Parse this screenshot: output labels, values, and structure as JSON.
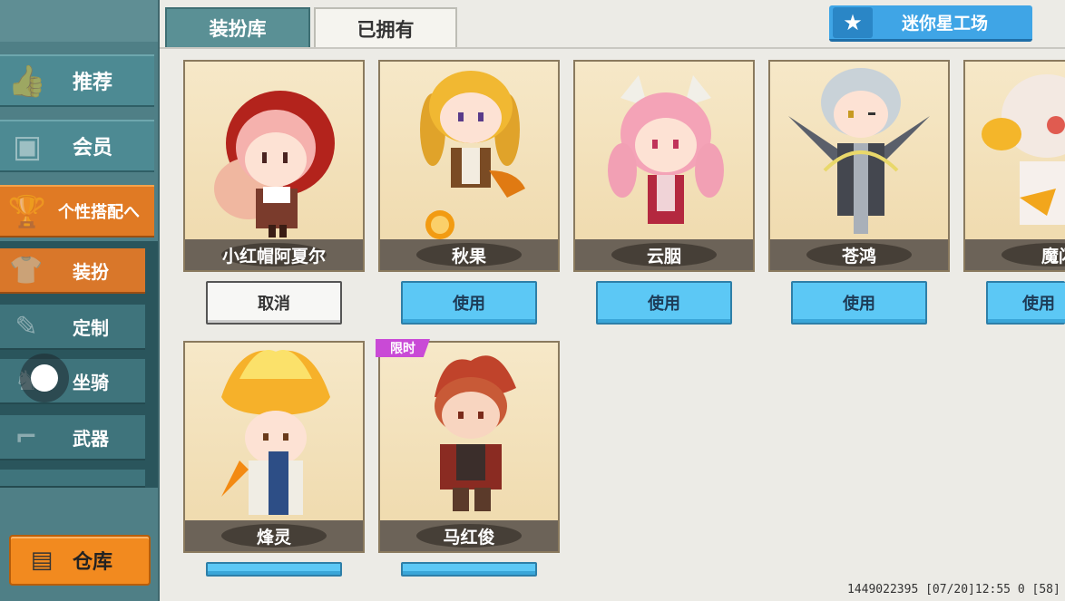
{
  "sidebar": {
    "items": [
      {
        "label": "推荐",
        "icon": "thumbs-up-icon"
      },
      {
        "label": "会员",
        "icon": "vip-icon"
      },
      {
        "label": "个性搭配へ",
        "icon": "trophy-icon"
      }
    ],
    "subitems": [
      {
        "label": "装扮",
        "icon": "shirt-icon"
      },
      {
        "label": "定制",
        "icon": "pencil-icon"
      },
      {
        "label": "坐骑",
        "icon": "mount-icon"
      },
      {
        "label": "武器",
        "icon": "revolver-icon"
      }
    ],
    "warehouse_label": "仓库"
  },
  "tabs": {
    "library": "装扮库",
    "owned": "已拥有"
  },
  "workshop_label": "迷你星工场",
  "cards": [
    {
      "name": "小红帽阿夏尔",
      "button": "取消"
    },
    {
      "name": "秋果",
      "button": "使用"
    },
    {
      "name": "云胭",
      "button": "使用"
    },
    {
      "name": "苍鸿",
      "button": "使用"
    },
    {
      "name": "魔闪",
      "button": "使用"
    },
    {
      "name": "烽灵",
      "button": ""
    },
    {
      "name": "马红俊",
      "button": "",
      "badge": "限时"
    }
  ],
  "status_text": "1449022395  [07/20]12:55 0  [58]"
}
